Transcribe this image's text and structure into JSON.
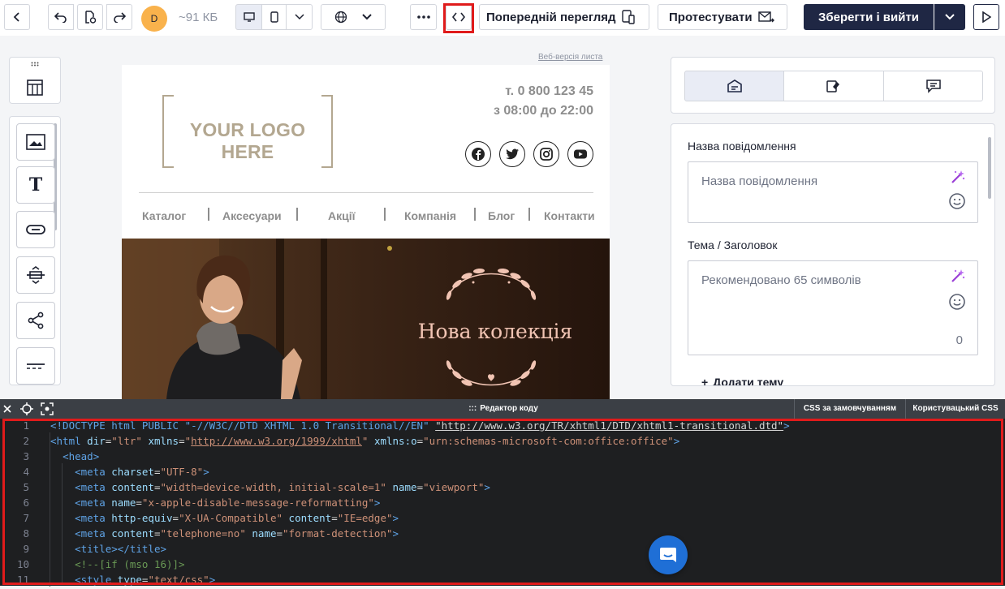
{
  "toolbar": {
    "avatar_letter": "D",
    "size_label": "~91 КБ",
    "preview_label": "Попередній перегляд",
    "test_label": "Протестувати",
    "save_exit_label": "Зберегти і вийти"
  },
  "email": {
    "web_version_link": "Веб-версія листа",
    "logo_text": "YOUR LOGO HERE",
    "phone": "т. 0 800 123 45",
    "hours": "з 08:00 до 22:00",
    "nav": [
      "Каталог",
      "Аксесуари",
      "Акції",
      "Компанія",
      "Блог",
      "Контакти"
    ],
    "hero_title": "Нова колекція"
  },
  "right_panel": {
    "message_name_label": "Назва повідомлення",
    "message_name_placeholder": "Назва повідомлення",
    "subject_label": "Тема / Заголовок",
    "subject_placeholder": "Рекомендовано 65 символів",
    "subject_counter": "0",
    "add_subject_label": "Додати тему"
  },
  "editor": {
    "title": "Редактор коду",
    "custom_css_tab": "CSS за замовчуванням",
    "user_css_tab": "Користувацький CSS",
    "lines": [
      {
        "n": "1",
        "html": "<span class=\"tag\">&lt;!DOCTYPE html PUBLIC \"-//W3C//DTD XHTML 1.0 Transitional//EN\"</span> <span class=\"lnk\">\"http://www.w3.org/TR/xhtml1/DTD/xhtml1-transitional.dtd\"</span><span class=\"tag\">&gt;</span>"
      },
      {
        "n": "2",
        "html": "<span class=\"tag\">&lt;html</span> <span class=\"attr\">dir</span>=<span class=\"str\">\"ltr\"</span> <span class=\"attr\">xmlns</span>=<span class=\"str\">\"<u>http://www.w3.org/1999/xhtml</u>\"</span> <span class=\"attr\">xmlns:o</span>=<span class=\"str\">\"urn:schemas-microsoft-com:office:office\"</span><span class=\"tag\">&gt;</span>"
      },
      {
        "n": "3",
        "html": "  <span class=\"tag\">&lt;head&gt;</span>"
      },
      {
        "n": "4",
        "html": "    <span class=\"tag\">&lt;meta</span> <span class=\"attr\">charset</span>=<span class=\"str\">\"UTF-8\"</span><span class=\"tag\">&gt;</span>"
      },
      {
        "n": "5",
        "html": "    <span class=\"tag\">&lt;meta</span> <span class=\"attr\">content</span>=<span class=\"str\">\"width=device-width, initial-scale=1\"</span> <span class=\"attr\">name</span>=<span class=\"str\">\"viewport\"</span><span class=\"tag\">&gt;</span>"
      },
      {
        "n": "6",
        "html": "    <span class=\"tag\">&lt;meta</span> <span class=\"attr\">name</span>=<span class=\"str\">\"x-apple-disable-message-reformatting\"</span><span class=\"tag\">&gt;</span>"
      },
      {
        "n": "7",
        "html": "    <span class=\"tag\">&lt;meta</span> <span class=\"attr\">http-equiv</span>=<span class=\"str\">\"X-UA-Compatible\"</span> <span class=\"attr\">content</span>=<span class=\"str\">\"IE=edge\"</span><span class=\"tag\">&gt;</span>"
      },
      {
        "n": "8",
        "html": "    <span class=\"tag\">&lt;meta</span> <span class=\"attr\">content</span>=<span class=\"str\">\"telephone=no\"</span> <span class=\"attr\">name</span>=<span class=\"str\">\"format-detection\"</span><span class=\"tag\">&gt;</span>"
      },
      {
        "n": "9",
        "html": "    <span class=\"tag\">&lt;title&gt;&lt;/title&gt;</span>"
      },
      {
        "n": "10",
        "html": "    <span class=\"cmt\">&lt;!--[if (mso 16)]&gt;</span>"
      },
      {
        "n": "11",
        "html": "    <span class=\"tag\">&lt;style</span> <span class=\"attr\">type</span>=<span class=\"str\">\"text/css\"</span><span class=\"tag\">&gt;</span>"
      }
    ]
  }
}
